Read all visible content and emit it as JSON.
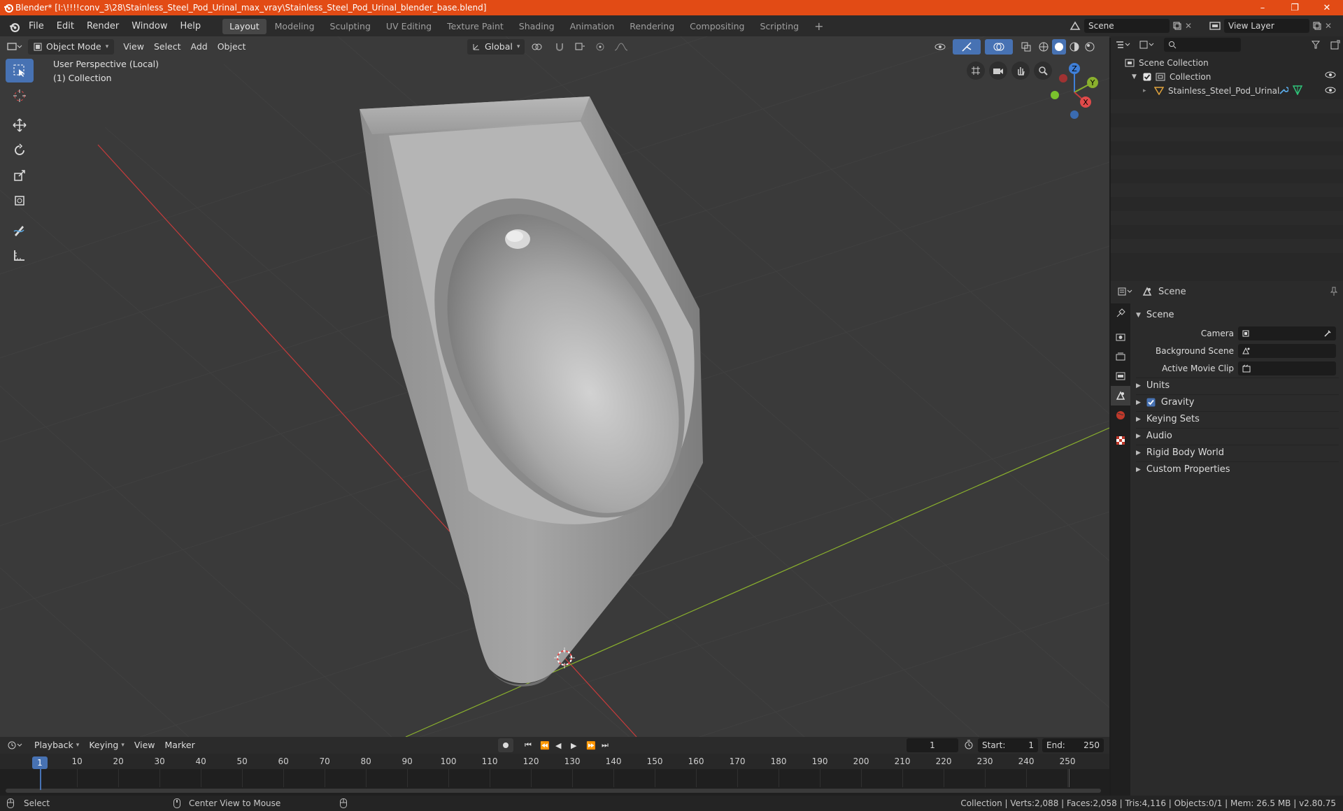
{
  "window": {
    "title": "Blender* [I:\\!!!!conv_3\\28\\Stainless_Steel_Pod_Urinal_max_vray\\Stainless_Steel_Pod_Urinal_blender_base.blend]",
    "minimize": "–",
    "maximize": "❐",
    "close": "✕"
  },
  "menu": [
    "File",
    "Edit",
    "Render",
    "Window",
    "Help"
  ],
  "workspaces": [
    "Layout",
    "Modeling",
    "Sculpting",
    "UV Editing",
    "Texture Paint",
    "Shading",
    "Animation",
    "Rendering",
    "Compositing",
    "Scripting"
  ],
  "active_workspace": "Layout",
  "add_workspace": "+",
  "scene_selector": "Scene",
  "view_layer_selector": "View Layer",
  "viewport_header": {
    "mode": "Object Mode",
    "menus": [
      "View",
      "Select",
      "Add",
      "Object"
    ],
    "orientation": "Global"
  },
  "viewport_overlay": {
    "perspective": "User Perspective (Local)",
    "collection": "(1) Collection"
  },
  "gizmo": {
    "z": "Z",
    "y": "Y",
    "x": "X"
  },
  "outliner": {
    "root": "Scene Collection",
    "collection": "Collection",
    "object": "Stainless_Steel_Pod_Urinal"
  },
  "properties": {
    "context": "Scene",
    "section": "Scene",
    "fields": [
      {
        "label": "Camera",
        "value": ""
      },
      {
        "label": "Background Scene",
        "value": ""
      },
      {
        "label": "Active Movie Clip",
        "value": ""
      }
    ],
    "panels": [
      "Units",
      "Gravity",
      "Keying Sets",
      "Audio",
      "Rigid Body World",
      "Custom Properties"
    ],
    "gravity_checked": true
  },
  "timeline": {
    "menus": [
      "Playback",
      "Keying",
      "View",
      "Marker"
    ],
    "current_frame": "1",
    "start_label": "Start:",
    "start": "1",
    "end_label": "End:",
    "end": "250",
    "ticks": [
      "1",
      "10",
      "20",
      "30",
      "40",
      "50",
      "60",
      "70",
      "80",
      "90",
      "100",
      "110",
      "120",
      "130",
      "140",
      "150",
      "160",
      "170",
      "180",
      "190",
      "200",
      "210",
      "220",
      "230",
      "240",
      "250"
    ]
  },
  "status": {
    "select": "Select",
    "center": "Center View to Mouse",
    "info": "Collection | Verts:2,088 | Faces:2,058 | Tris:4,116 | Objects:0/1 | Mem: 26.5 MB | v2.80.75"
  },
  "colors": {
    "accent": "#4772b3",
    "titlebar": "#e24b15",
    "x_axis": "#c73b3b",
    "y_axis": "#8ab02d",
    "z_axis": "#3f7fd8"
  }
}
